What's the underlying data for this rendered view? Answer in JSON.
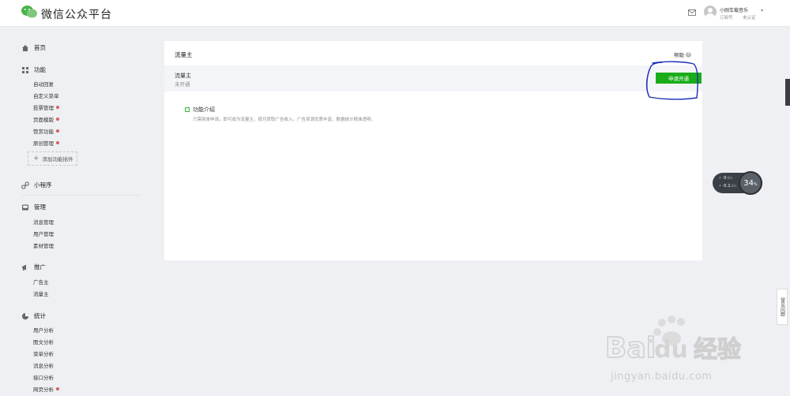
{
  "header": {
    "brand": "微信公众平台",
    "account_name": "小刚车载音乐",
    "account_type": "订阅号",
    "verify_status": "未认证"
  },
  "sidebar": {
    "home": "首页",
    "function": {
      "title": "功能",
      "items": [
        {
          "label": "自动回复",
          "dot": false
        },
        {
          "label": "自定义菜单",
          "dot": false
        },
        {
          "label": "投票管理",
          "dot": true
        },
        {
          "label": "页面模版",
          "dot": true
        },
        {
          "label": "赞赏功能",
          "dot": true
        },
        {
          "label": "原创管理",
          "dot": true
        }
      ],
      "add_plugin": "添加功能插件"
    },
    "miniprogram": "小程序",
    "management": {
      "title": "管理",
      "items": [
        "消息管理",
        "用户管理",
        "素材管理"
      ]
    },
    "promotion": {
      "title": "推广",
      "items": [
        "广告主",
        "流量主"
      ]
    },
    "statistics": {
      "title": "统计",
      "items": [
        {
          "label": "用户分析",
          "dot": false
        },
        {
          "label": "图文分析",
          "dot": false
        },
        {
          "label": "菜单分析",
          "dot": false
        },
        {
          "label": "消息分析",
          "dot": false
        },
        {
          "label": "接口分析",
          "dot": false
        },
        {
          "label": "网页分析",
          "dot": true
        }
      ]
    }
  },
  "main": {
    "title": "流量主",
    "help": "帮助",
    "status_name": "流量主",
    "status_state": "未开通",
    "apply_button": "申请开通",
    "intro_title": "功能介绍",
    "intro_desc": "只需简单申请，即可成为流量主，按月获取广告收入。广告资源优质丰富，数据统计精准透明。"
  },
  "speed_widget": {
    "upload": "0",
    "upload_unit": "K/s",
    "download": "0.1",
    "download_unit": "K/s",
    "percent": "34",
    "percent_unit": "%"
  },
  "faq": "常见问题",
  "watermark": {
    "domain": "jingyan.baidu.com"
  },
  "colors": {
    "accent_green": "#1aad19",
    "alert_dot": "#e15f63",
    "annotation_blue": "#1e2fb5"
  }
}
